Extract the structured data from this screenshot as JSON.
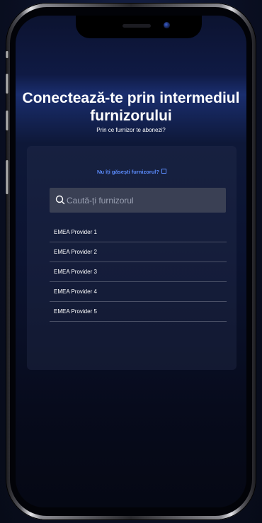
{
  "page": {
    "title": "Conectează-te prin intermediul furnizorului",
    "subtitle": "Prin ce furnizor te abonezi?"
  },
  "help_link": {
    "label": "Nu îți găsești furnizorul?",
    "icon": "external-link-icon"
  },
  "search": {
    "placeholder": "Caută-ți furnizorul",
    "value": "",
    "icon": "search-icon"
  },
  "providers": [
    {
      "label": "EMEA Provider 1"
    },
    {
      "label": "EMEA Provider 2"
    },
    {
      "label": "EMEA Provider 3"
    },
    {
      "label": "EMEA Provider 4"
    },
    {
      "label": "EMEA Provider 5"
    }
  ],
  "colors": {
    "link": "#5c8dff",
    "background": "#0a0f22",
    "search_field": "#3a4054",
    "divider": "#4a5066"
  }
}
